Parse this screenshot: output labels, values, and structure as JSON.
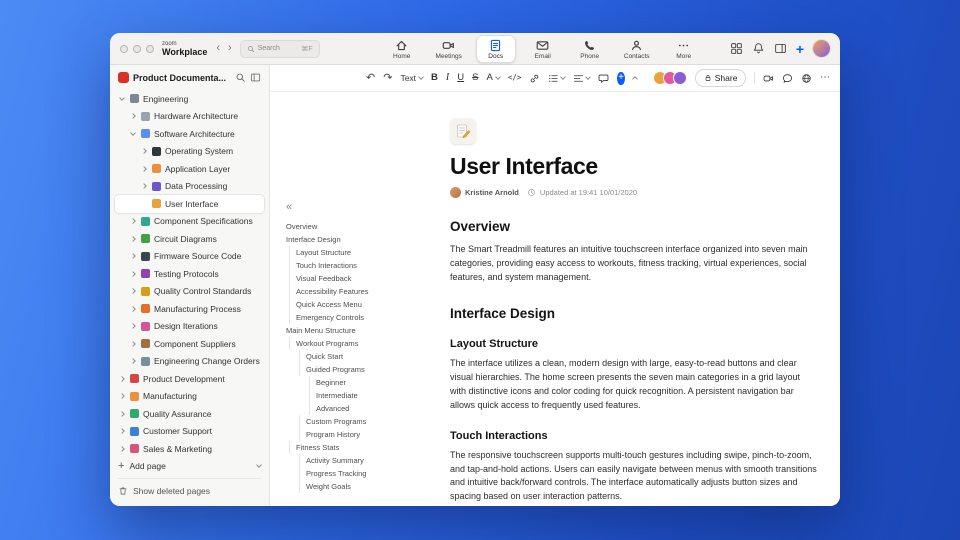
{
  "titlebar": {
    "logo_top": "zoom",
    "logo_bottom": "Workplace",
    "search": {
      "placeholder": "Search",
      "shortcut": "⌘F"
    },
    "tabs": [
      {
        "label": "Home",
        "icon": "home-icon",
        "active": false
      },
      {
        "label": "Meetings",
        "icon": "meetings-icon",
        "active": false
      },
      {
        "label": "Docs",
        "icon": "docs-icon",
        "active": true
      },
      {
        "label": "Email",
        "icon": "email-icon",
        "active": false
      },
      {
        "label": "Phone",
        "icon": "phone-icon",
        "active": false
      },
      {
        "label": "Contacts",
        "icon": "contacts-icon",
        "active": false
      },
      {
        "label": "More",
        "icon": "more-icon",
        "active": false
      }
    ]
  },
  "sidebar": {
    "workspace_title": "Product Documenta...",
    "add_page_label": "Add page",
    "show_deleted_label": "Show deleted pages",
    "tree": [
      {
        "label": "Engineering",
        "level": 0,
        "chevron": "down",
        "icon": "gear-icon",
        "color": "#7d8794",
        "selected": false
      },
      {
        "label": "Hardware Architecture",
        "level": 1,
        "chevron": "right",
        "icon": "chip-icon",
        "color": "#9aa3ad",
        "selected": false
      },
      {
        "label": "Software Architecture",
        "level": 1,
        "chevron": "down",
        "icon": "stack-icon",
        "color": "#5b8def",
        "selected": false
      },
      {
        "label": "Operating System",
        "level": 2,
        "chevron": "right",
        "icon": "terminal-icon",
        "color": "#2f3640",
        "selected": false
      },
      {
        "label": "Application Layer",
        "level": 2,
        "chevron": "right",
        "icon": "layers-icon",
        "color": "#e8923d",
        "selected": false
      },
      {
        "label": "Data Processing",
        "level": 2,
        "chevron": "right",
        "icon": "database-icon",
        "color": "#6e56cf",
        "selected": false
      },
      {
        "label": "User Interface",
        "level": 2,
        "chevron": "none",
        "icon": "memo-icon",
        "color": "#e8a33d",
        "selected": true
      },
      {
        "label": "Component Specifications",
        "level": 1,
        "chevron": "right",
        "icon": "spec-icon",
        "color": "#2fa98c",
        "selected": false
      },
      {
        "label": "Circuit Diagrams",
        "level": 1,
        "chevron": "right",
        "icon": "circuit-icon",
        "color": "#43a047",
        "selected": false
      },
      {
        "label": "Firmware Source Code",
        "level": 1,
        "chevron": "right",
        "icon": "code-icon",
        "color": "#37474f",
        "selected": false
      },
      {
        "label": "Testing Protocols",
        "level": 1,
        "chevron": "right",
        "icon": "flask-icon",
        "color": "#8e44ad",
        "selected": false
      },
      {
        "label": "Quality Control Standards",
        "level": 1,
        "chevron": "right",
        "icon": "medal-icon",
        "color": "#d4a017",
        "selected": false
      },
      {
        "label": "Manufacturing Process",
        "level": 1,
        "chevron": "right",
        "icon": "factory-icon",
        "color": "#e2702a",
        "selected": false
      },
      {
        "label": "Design Iterations",
        "level": 1,
        "chevron": "right",
        "icon": "palette-icon",
        "color": "#d6559a",
        "selected": false
      },
      {
        "label": "Component Suppliers",
        "level": 1,
        "chevron": "right",
        "icon": "box-icon",
        "color": "#a07040",
        "selected": false
      },
      {
        "label": "Engineering Change Orders",
        "level": 1,
        "chevron": "right",
        "icon": "clipboard-icon",
        "color": "#78909c",
        "selected": false
      },
      {
        "label": "Product Development",
        "level": 0,
        "chevron": "right",
        "icon": "rocket-icon",
        "color": "#d64545",
        "selected": false
      },
      {
        "label": "Manufacturing",
        "level": 0,
        "chevron": "right",
        "icon": "wrench-icon",
        "color": "#e8923d",
        "selected": false
      },
      {
        "label": "Quality Assurance",
        "level": 0,
        "chevron": "right",
        "icon": "shield-icon",
        "color": "#2fa96c",
        "selected": false
      },
      {
        "label": "Customer Support",
        "level": 0,
        "chevron": "right",
        "icon": "support-icon",
        "color": "#3b82d6",
        "selected": false
      },
      {
        "label": "Sales & Marketing",
        "level": 0,
        "chevron": "right",
        "icon": "chart-icon",
        "color": "#d65480",
        "selected": false
      }
    ]
  },
  "outline": {
    "items": [
      {
        "label": "Overview",
        "level": 0
      },
      {
        "label": "Interface Design",
        "level": 0
      },
      {
        "label": "Layout Structure",
        "level": 1
      },
      {
        "label": "Touch Interactions",
        "level": 1
      },
      {
        "label": "Visual Feedback",
        "level": 1
      },
      {
        "label": "Accessibility Features",
        "level": 1
      },
      {
        "label": "Quick Access Menu",
        "level": 1
      },
      {
        "label": "Emergency Controls",
        "level": 1
      },
      {
        "label": "Main Menu Structure",
        "level": 0
      },
      {
        "label": "Workout Programs",
        "level": 1
      },
      {
        "label": "Quick Start",
        "level": 2
      },
      {
        "label": "Guided Programs",
        "level": 2
      },
      {
        "label": "Beginner",
        "level": 3
      },
      {
        "label": "Intermediate",
        "level": 3
      },
      {
        "label": "Advanced",
        "level": 3
      },
      {
        "label": "Custom Programs",
        "level": 2
      },
      {
        "label": "Program History",
        "level": 2
      },
      {
        "label": "Fitness Stats",
        "level": 1
      },
      {
        "label": "Activity Summary",
        "level": 2
      },
      {
        "label": "Progress Tracking",
        "level": 2
      },
      {
        "label": "Weight Goals",
        "level": 2
      }
    ]
  },
  "editor_toolbar": {
    "text_style_label": "Text",
    "share_label": "Share",
    "avatars": [
      "#e8a33d",
      "#e3599a",
      "#8a5cd6"
    ]
  },
  "doc": {
    "title": "User Interface",
    "author": "Kristine Arnold",
    "updated": "Updated at 19:41 10/01/2020",
    "sections": [
      {
        "type": "h2",
        "text": "Overview"
      },
      {
        "type": "p",
        "text": "The Smart Treadmill features an intuitive touchscreen interface organized into seven main categories, providing easy access to workouts, fitness tracking, virtual experiences, social features, and system management."
      },
      {
        "type": "h2",
        "text": "Interface Design"
      },
      {
        "type": "h3",
        "text": "Layout Structure"
      },
      {
        "type": "p",
        "text": "The interface utilizes a clean, modern design with large, easy-to-read buttons and clear visual hierarchies. The home screen presents the seven main categories in a grid layout with distinctive icons and color coding for quick recognition. A persistent navigation bar allows quick access to frequently used features."
      },
      {
        "type": "h3",
        "text": "Touch Interactions"
      },
      {
        "type": "p",
        "text": "The responsive touchscreen supports multi-touch gestures including swipe, pinch-to-zoom, and tap-and-hold actions. Users can easily navigate between menus with smooth transitions and intuitive back/forward controls. The interface automatically adjusts button sizes and spacing based on user interaction patterns."
      }
    ]
  },
  "accent_color": "#0b5cff"
}
